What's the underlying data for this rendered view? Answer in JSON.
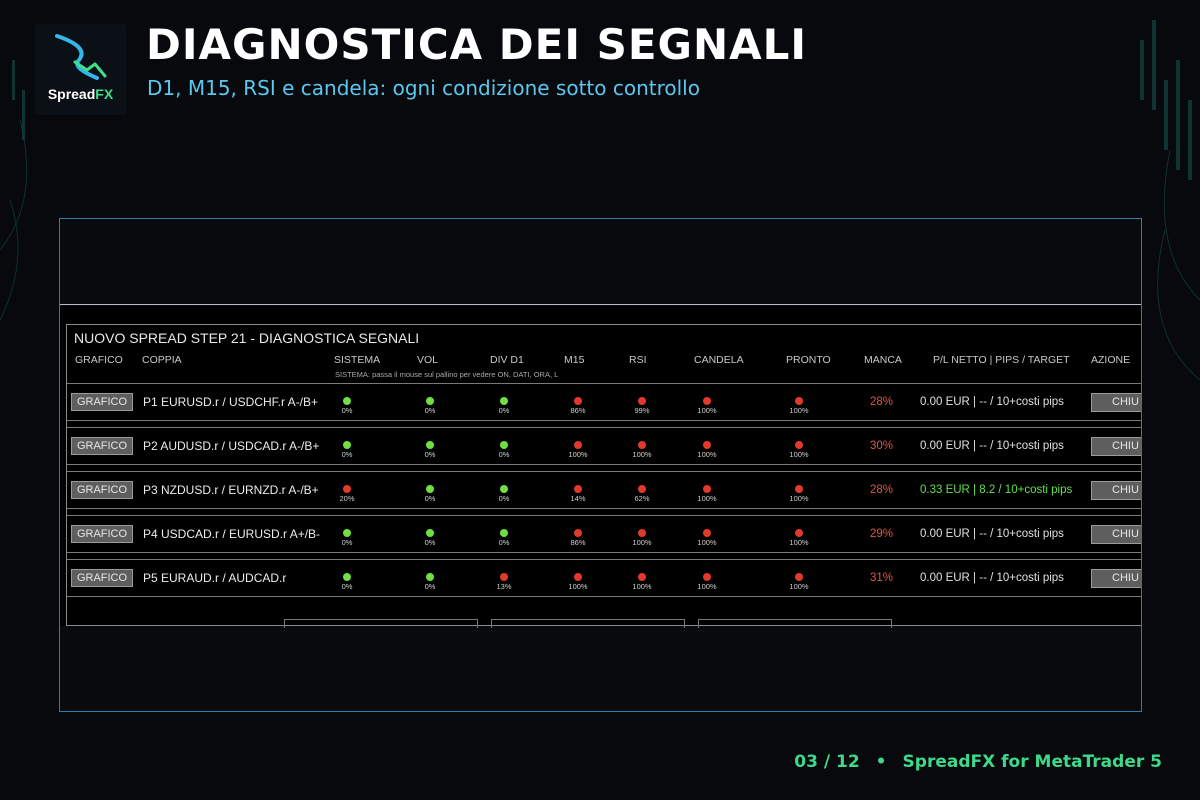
{
  "slide": {
    "title": "DIAGNOSTICA DEI SEGNALI",
    "subtitle": "D1, M15, RSI e candela: ogni condizione sotto controllo",
    "logo_text": "Spread",
    "logo_text_accent": "FX",
    "footer_page": "03 / 12",
    "footer_separator": "•",
    "footer_product": "SpreadFX for MetaTrader 5"
  },
  "panel": {
    "title": "NUOVO SPREAD STEP 21 - DIAGNOSTICA SEGNALI",
    "hint": "SISTEMA: passa il mouse sul pallino per vedere ON, DATI, ORA, L",
    "headers": {
      "grafico": "GRAFICO",
      "coppia": "COPPIA",
      "sistema": "SISTEMA",
      "vol": "VOL",
      "divd1": "DIV D1",
      "m15": "M15",
      "rsi": "RSI",
      "candela": "CANDELA",
      "pronto": "PRONTO",
      "manca": "MANCA",
      "pl": "P/L NETTO | PIPS / TARGET",
      "azione": "AZIONE"
    }
  },
  "rows": [
    {
      "grafico_label": "GRAFICO",
      "pair": "P1  EURUSD.r / USDCHF.r A-/B+",
      "signals": [
        {
          "name": "sistema",
          "status": "green",
          "pct": "0%"
        },
        {
          "name": "vol",
          "status": "green",
          "pct": "0%"
        },
        {
          "name": "divd1",
          "status": "green",
          "pct": "0%"
        },
        {
          "name": "m15",
          "status": "red",
          "pct": "86%"
        },
        {
          "name": "rsi",
          "status": "red",
          "pct": "99%"
        },
        {
          "name": "candela",
          "status": "red",
          "pct": "100%"
        },
        {
          "name": "pronto",
          "status": "red",
          "pct": "100%"
        }
      ],
      "manca": "28%",
      "pl": "0.00 EUR | -- / 10+costi pips",
      "pl_positive": false,
      "action_label": "CHIU"
    },
    {
      "grafico_label": "GRAFICO",
      "pair": "P2  AUDUSD.r / USDCAD.r A-/B+",
      "signals": [
        {
          "name": "sistema",
          "status": "green",
          "pct": "0%"
        },
        {
          "name": "vol",
          "status": "green",
          "pct": "0%"
        },
        {
          "name": "divd1",
          "status": "green",
          "pct": "0%"
        },
        {
          "name": "m15",
          "status": "red",
          "pct": "100%"
        },
        {
          "name": "rsi",
          "status": "red",
          "pct": "100%"
        },
        {
          "name": "candela",
          "status": "red",
          "pct": "100%"
        },
        {
          "name": "pronto",
          "status": "red",
          "pct": "100%"
        }
      ],
      "manca": "30%",
      "pl": "0.00 EUR | -- / 10+costi pips",
      "pl_positive": false,
      "action_label": "CHIU"
    },
    {
      "grafico_label": "GRAFICO",
      "pair": "P3  NZDUSD.r / EURNZD.r A-/B+",
      "signals": [
        {
          "name": "sistema",
          "status": "red",
          "pct": "20%"
        },
        {
          "name": "vol",
          "status": "green",
          "pct": "0%"
        },
        {
          "name": "divd1",
          "status": "green",
          "pct": "0%"
        },
        {
          "name": "m15",
          "status": "red",
          "pct": "14%"
        },
        {
          "name": "rsi",
          "status": "red",
          "pct": "62%"
        },
        {
          "name": "candela",
          "status": "red",
          "pct": "100%"
        },
        {
          "name": "pronto",
          "status": "red",
          "pct": "100%"
        }
      ],
      "manca": "28%",
      "pl": "0.33 EUR | 8.2 / 10+costi pips",
      "pl_positive": true,
      "action_label": "CHIU"
    },
    {
      "grafico_label": "GRAFICO",
      "pair": "P4  USDCAD.r / EURUSD.r A+/B-",
      "signals": [
        {
          "name": "sistema",
          "status": "green",
          "pct": "0%"
        },
        {
          "name": "vol",
          "status": "green",
          "pct": "0%"
        },
        {
          "name": "divd1",
          "status": "green",
          "pct": "0%"
        },
        {
          "name": "m15",
          "status": "red",
          "pct": "86%"
        },
        {
          "name": "rsi",
          "status": "red",
          "pct": "100%"
        },
        {
          "name": "candela",
          "status": "red",
          "pct": "100%"
        },
        {
          "name": "pronto",
          "status": "red",
          "pct": "100%"
        }
      ],
      "manca": "29%",
      "pl": "0.00 EUR | -- / 10+costi pips",
      "pl_positive": false,
      "action_label": "CHIU"
    },
    {
      "grafico_label": "GRAFICO",
      "pair": "P5  EURAUD.r / AUDCAD.r",
      "signals": [
        {
          "name": "sistema",
          "status": "green",
          "pct": "0%"
        },
        {
          "name": "vol",
          "status": "green",
          "pct": "0%"
        },
        {
          "name": "divd1",
          "status": "red",
          "pct": "13%"
        },
        {
          "name": "m15",
          "status": "red",
          "pct": "100%"
        },
        {
          "name": "rsi",
          "status": "red",
          "pct": "100%"
        },
        {
          "name": "candela",
          "status": "red",
          "pct": "100%"
        },
        {
          "name": "pronto",
          "status": "red",
          "pct": "100%"
        }
      ],
      "manca": "31%",
      "pl": "0.00 EUR | -- / 10+costi pips",
      "pl_positive": false,
      "action_label": "CHIU"
    }
  ],
  "colors": {
    "signal_green": "#6fe040",
    "signal_red": "#e23a2a",
    "title_white": "#ffffff",
    "subtitle_blue": "#5ac8f0",
    "footer_green": "#3fd88a",
    "frame_border": "#2d7fa8",
    "manca_red": "#e05548",
    "pl_positive_green": "#5fe04a"
  }
}
